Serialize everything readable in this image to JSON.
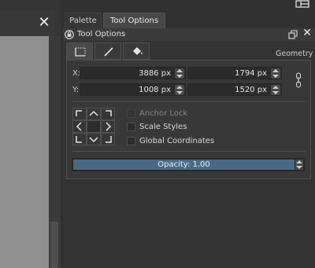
{
  "left_panel": {
    "close_symbol": "✕"
  },
  "tabs": [
    {
      "label": "Palette",
      "active": false
    },
    {
      "label": "Tool Options",
      "active": true
    }
  ],
  "docker": {
    "title": "Tool Options",
    "close_symbol": "✕",
    "icons": [
      "lock-icon",
      "float-icon",
      "close-icon"
    ]
  },
  "tool_tabs": [
    {
      "icon": "rectangle-select-icon",
      "active": true
    },
    {
      "icon": "line-icon",
      "active": false
    },
    {
      "icon": "fill-bucket-icon",
      "active": false
    }
  ],
  "geometry": {
    "section_label": "Geometry",
    "x_label": "X:",
    "y_label": "Y:",
    "x_value": "3886 px",
    "width_value": "1794 px",
    "y_value": "1008 px",
    "height_value": "1520 px",
    "chain_icon": "chain-link-icon"
  },
  "options": {
    "anchor_lock": {
      "label": "Anchor Lock",
      "checked": false,
      "enabled": false
    },
    "scale_styles": {
      "label": "Scale Styles",
      "checked": false,
      "enabled": true
    },
    "global_coordinates": {
      "label": "Global Coordinates",
      "checked": false,
      "enabled": true
    }
  },
  "opacity": {
    "label": "Opacity: 1.00",
    "value": 1.0
  },
  "colors": {
    "background": "#313131",
    "slider_fill": "#4a6986",
    "canvas": "#8f8f8f"
  }
}
